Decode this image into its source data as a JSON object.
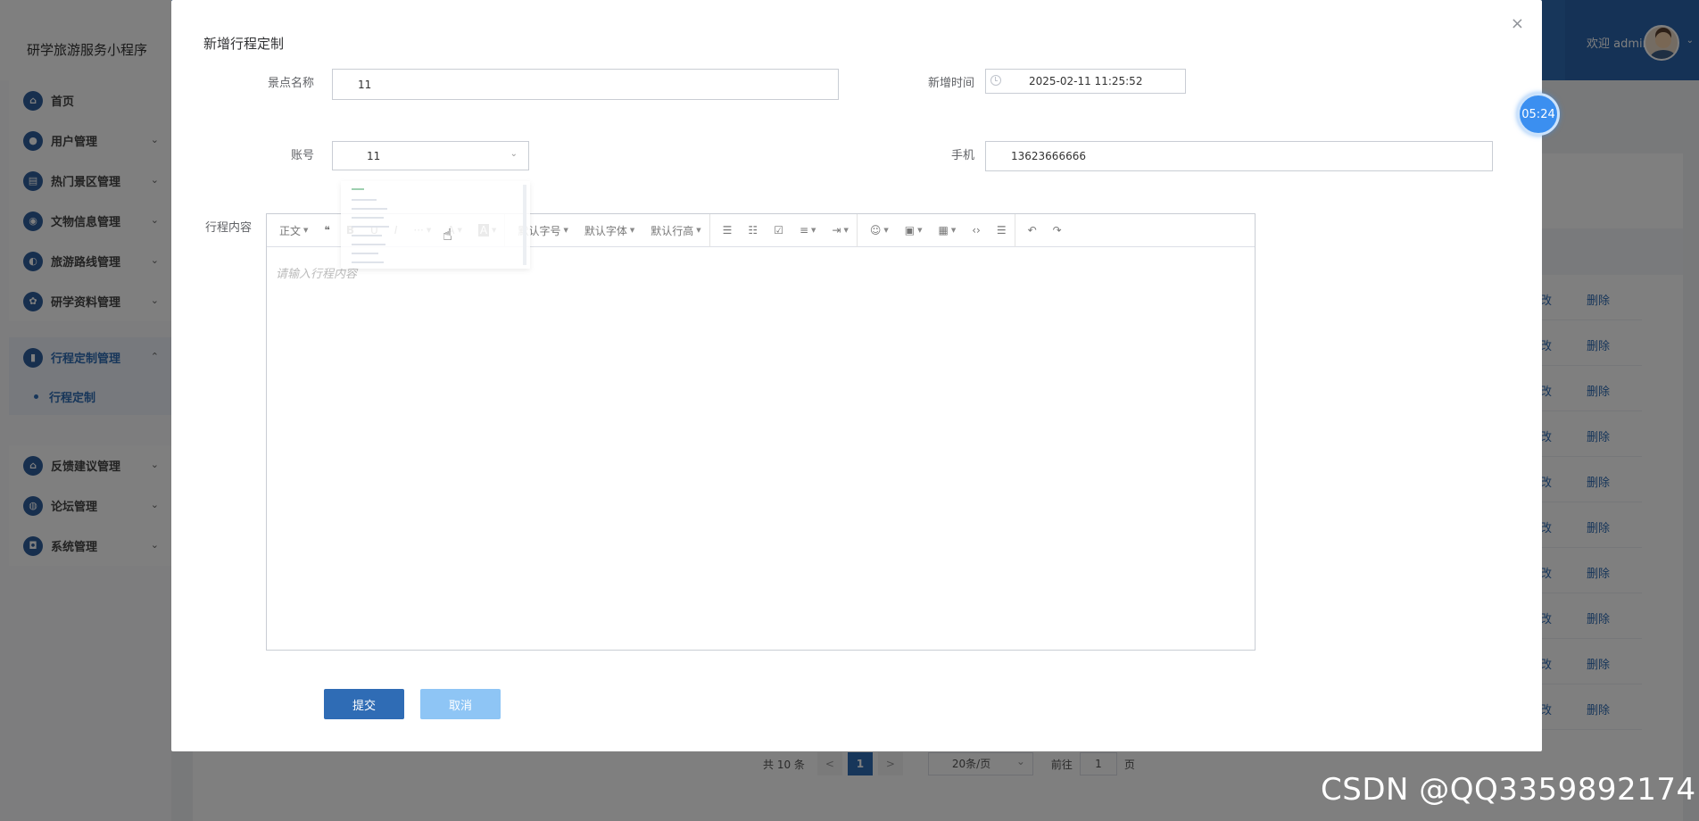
{
  "app": {
    "title": "研学旅游服务小程序"
  },
  "user": {
    "welcome": "欢迎 admin"
  },
  "sidebar": {
    "items": [
      {
        "label": "首页",
        "icon": "home-icon"
      },
      {
        "label": "用户管理",
        "icon": "user-icon"
      },
      {
        "label": "热门景区管理",
        "icon": "scenic-icon"
      },
      {
        "label": "文物信息管理",
        "icon": "relic-icon"
      },
      {
        "label": "旅游路线管理",
        "icon": "route-icon"
      },
      {
        "label": "研学资料管理",
        "icon": "material-icon"
      },
      {
        "label": "行程定制管理",
        "icon": "itinerary-icon"
      },
      {
        "label": "反馈建议管理",
        "icon": "feedback-icon"
      },
      {
        "label": "论坛管理",
        "icon": "forum-icon"
      },
      {
        "label": "系统管理",
        "icon": "system-icon"
      }
    ],
    "active_sub": "行程定制"
  },
  "table": {
    "rows": [
      {
        "edit_tail": "改",
        "delete": "删除"
      },
      {
        "edit_tail": "改",
        "delete": "删除"
      },
      {
        "edit_tail": "改",
        "delete": "删除"
      },
      {
        "edit_tail": "改",
        "delete": "删除"
      },
      {
        "edit_tail": "改",
        "delete": "删除"
      },
      {
        "edit_tail": "改",
        "delete": "删除"
      },
      {
        "edit_tail": "改",
        "delete": "删除"
      },
      {
        "edit_tail": "改",
        "delete": "删除"
      },
      {
        "edit_tail": "改",
        "delete": "删除"
      },
      {
        "edit_tail": "改",
        "delete": "删除"
      }
    ]
  },
  "pagination": {
    "total": "共 10 条",
    "prev": "<",
    "current": "1",
    "next": ">",
    "page_size": "20条/页",
    "goto_label": "前往",
    "goto_value": "1",
    "page_suffix": "页"
  },
  "dialog": {
    "title": "新增行程定制",
    "close": "×",
    "fields": {
      "spot_label": "景点名称",
      "spot_value": "11",
      "time_label": "新增时间",
      "time_value": "2025-02-11 11:25:52",
      "account_label": "账号",
      "account_value": "11",
      "phone_label": "手机",
      "phone_value": "13623666666",
      "content_label": "行程内容"
    },
    "editor": {
      "toolbar": {
        "paragraph": "正文",
        "quote": "❝",
        "bold": "B",
        "underline": "U",
        "italic": "I",
        "more": "···",
        "font_color": "A",
        "bg_color": "A",
        "font_size": "默认字号",
        "font_family": "默认字体",
        "line_height": "默认行高",
        "bullet_list": "☰",
        "numbered_list": "☷",
        "todo": "☑",
        "align": "≡",
        "indent": "⇥",
        "emoji": "☺",
        "image": "▣",
        "table": "▦",
        "code": "‹›",
        "divider": "☰",
        "undo": "↶",
        "redo": "↷"
      },
      "placeholder": "请输入行程内容"
    },
    "submit": "提交",
    "cancel": "取消"
  },
  "timer": "05:24",
  "watermark": "CSDN @QQ3359892174"
}
